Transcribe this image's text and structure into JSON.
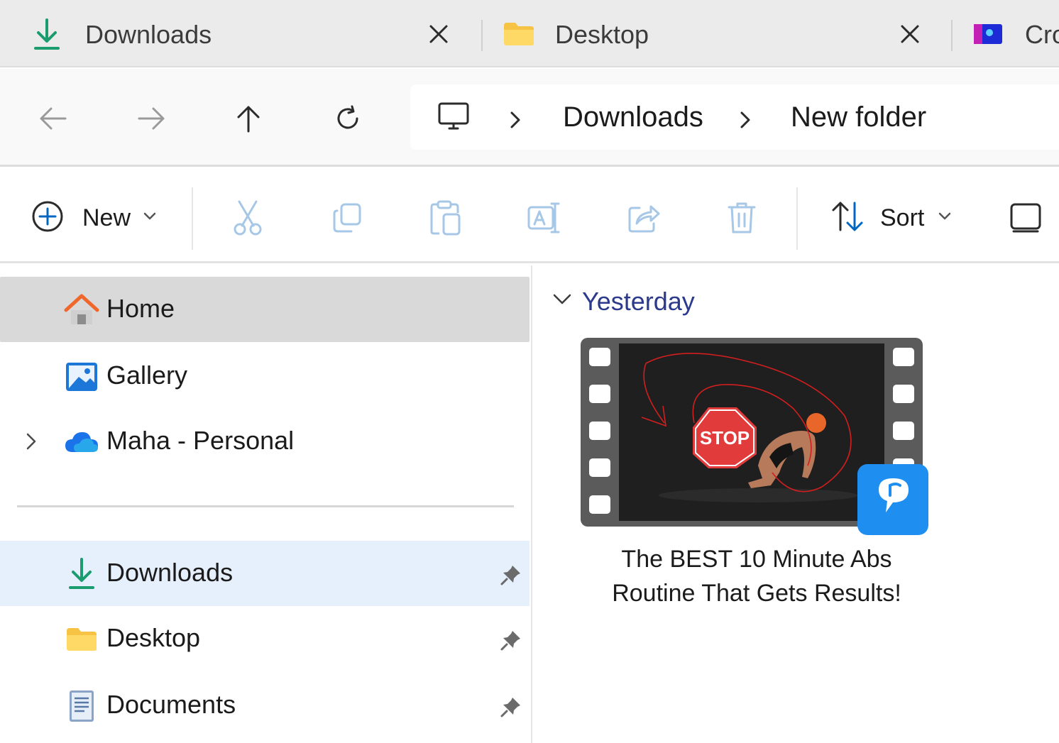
{
  "tabs": [
    {
      "label": "Downloads",
      "icon": "download-icon",
      "active": true
    },
    {
      "label": "Desktop",
      "icon": "folder-icon",
      "active": false
    },
    {
      "label": "Cro",
      "icon": "app-icon",
      "active": false
    }
  ],
  "address": {
    "root_icon": "this-pc-icon",
    "crumbs": [
      "Downloads",
      "New folder"
    ]
  },
  "toolbar": {
    "new_label": "New",
    "sort_label": "Sort"
  },
  "sidebar": {
    "top_items": [
      {
        "label": "Home",
        "icon": "home-icon",
        "selected": true
      },
      {
        "label": "Gallery",
        "icon": "gallery-icon"
      },
      {
        "label": "Maha - Personal",
        "icon": "onedrive-icon",
        "expandable": true
      }
    ],
    "pinned_items": [
      {
        "label": "Downloads",
        "icon": "download-icon",
        "pinned": true,
        "highlighted": true
      },
      {
        "label": "Desktop",
        "icon": "folder-icon",
        "pinned": true
      },
      {
        "label": "Documents",
        "icon": "documents-icon",
        "pinned": true
      }
    ]
  },
  "content": {
    "group_label": "Yesterday",
    "files": [
      {
        "name_line1": "The BEST 10 Minute Abs",
        "name_line2": "Routine That Gets Results!",
        "thumb_overlay_text": "STOP",
        "badge_icon": "app-badge-icon"
      }
    ]
  },
  "colors": {
    "accent": "#0067c0",
    "download_green": "#1a9c6e",
    "group_label": "#2c3a8c",
    "selected_bg": "#d9d9d9",
    "pinned_selected_bg": "#e5f0fc",
    "disabled_icon": "#a7c7e7"
  }
}
